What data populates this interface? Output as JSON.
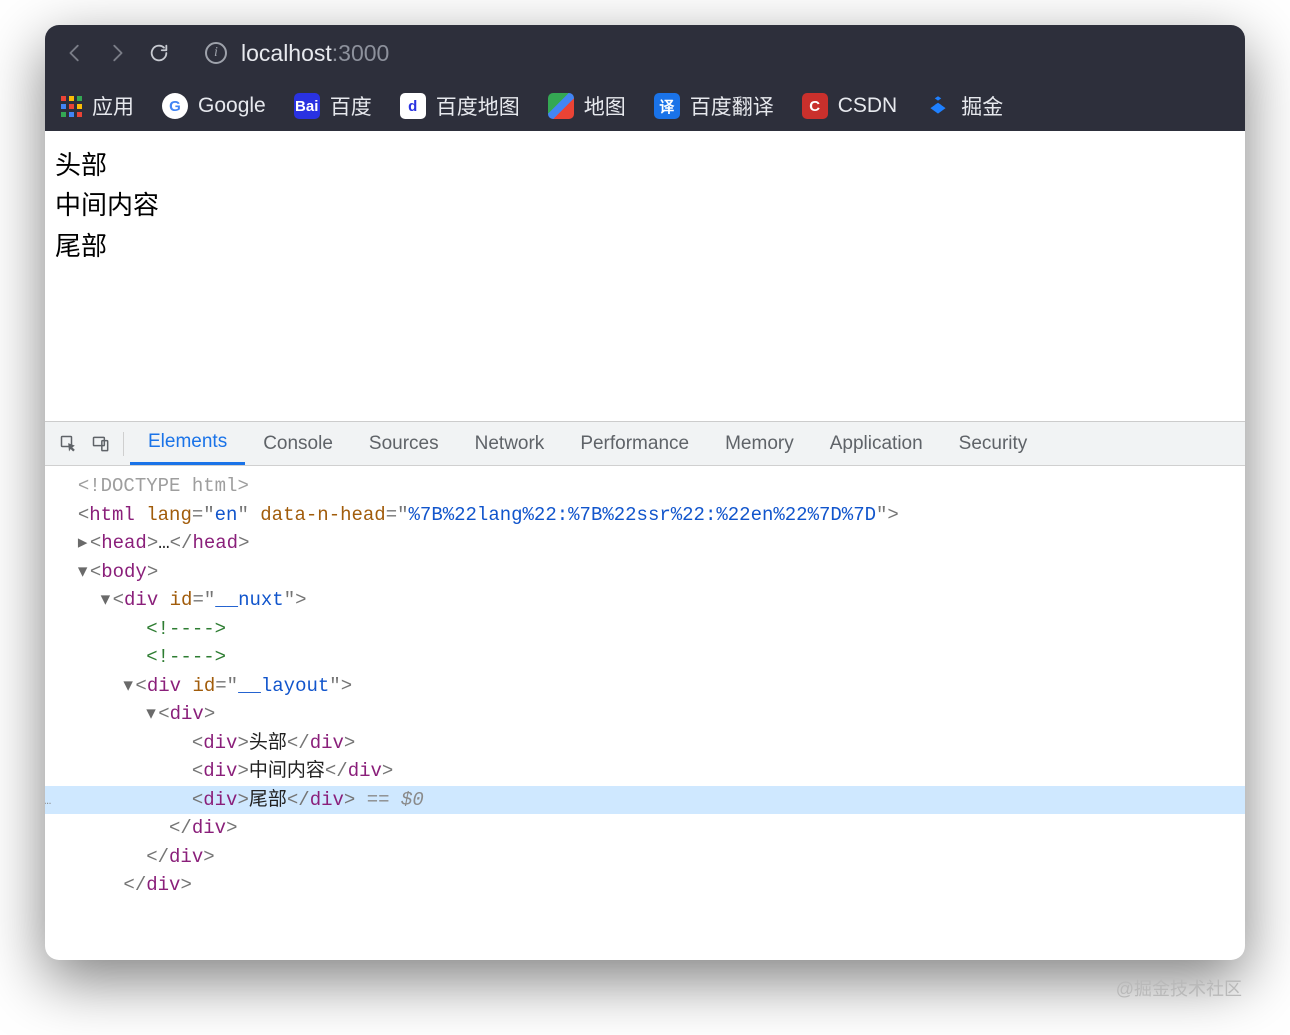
{
  "browser": {
    "url_host": "localhost",
    "url_port": ":3000",
    "bookmarks": {
      "apps": "应用",
      "google": "Google",
      "baidu": "百度",
      "baidumap": "百度地图",
      "map": "地图",
      "translate": "百度翻译",
      "csdn": "CSDN",
      "juejin": "掘金"
    }
  },
  "page": {
    "lines": {
      "header": "头部",
      "middle": "中间内容",
      "footer": "尾部"
    }
  },
  "devtools": {
    "tabs": {
      "elements": "Elements",
      "console": "Console",
      "sources": "Sources",
      "network": "Network",
      "performance": "Performance",
      "memory": "Memory",
      "application": "Application",
      "security": "Security"
    },
    "dom": {
      "doctype": "<!DOCTYPE html>",
      "html_attr_lang": "lang",
      "html_attr_lang_val": "en",
      "html_attr_nhead": "data-n-head",
      "html_attr_nhead_val": "%7B%22lang%22:%7B%22ssr%22:%22en%22%7D%7D",
      "head_tag": "head",
      "head_ellipsis": "…",
      "body_tag": "body",
      "div_tag": "div",
      "id_attr": "id",
      "nuxt_id": "__nuxt",
      "layout_id": "__layout",
      "comment": "<!---->",
      "text1": "头部",
      "text2": "中间内容",
      "text3": "尾部",
      "selection": " == $0"
    }
  },
  "watermark": "@掘金技术社区"
}
